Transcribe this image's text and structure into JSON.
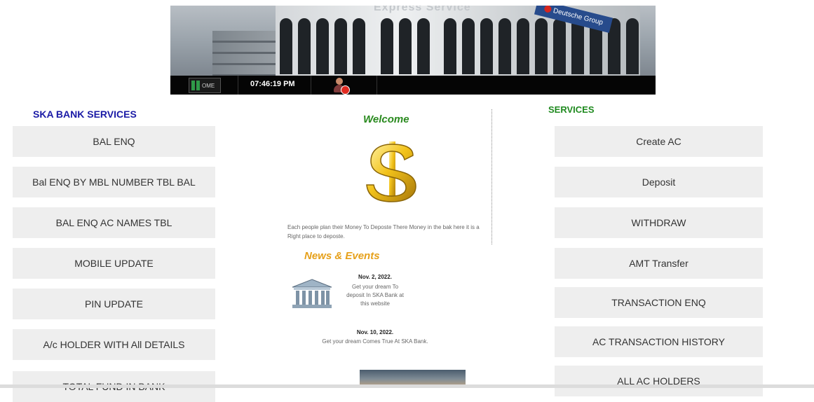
{
  "banner": {
    "title": "Express Service",
    "bank_sign": "Deutsche Group",
    "home_label": "OME",
    "clock": "07:46:19 PM"
  },
  "left_column": {
    "heading": "SKA BANK SERVICES",
    "buttons": [
      "BAL ENQ",
      "Bal ENQ BY MBL NUMBER TBL BAL",
      "BAL ENQ AC NAMES TBL",
      "MOBILE UPDATE",
      "PIN UPDATE",
      "A/c HOLDER WITH All DETAILS",
      "TOTAL FUND IN BANK"
    ]
  },
  "middle_column": {
    "welcome": "Welcome",
    "intro": "Each people plan their Money To Deposte There Money in the bak here it is a Right place to deposte.",
    "news_title": "News & Events",
    "news": [
      {
        "date": "Nov. 2, 2022.",
        "text": "Get your dream To deposit In SKA Bank at this website"
      },
      {
        "date": "Nov. 10, 2022.",
        "text": "Get your dream Comes True At SKA Bank."
      }
    ]
  },
  "right_column": {
    "heading": "SERVICES",
    "buttons": [
      "Create AC",
      "Deposit",
      "WITHDRAW",
      "AMT Transfer",
      "TRANSACTION ENQ",
      "AC TRANSACTION HISTORY",
      "ALL AC HOLDERS"
    ]
  },
  "icons": {
    "home": "home-icon",
    "user": "user-logout-icon",
    "dollar": "dollar-icon",
    "bank": "bank-building-icon"
  },
  "colors": {
    "left_heading": "#1a1aa6",
    "right_heading": "#1f8a1f",
    "welcome": "#2a8a1f",
    "news_title": "#e6a01a",
    "button_bg": "#eeeeee"
  }
}
